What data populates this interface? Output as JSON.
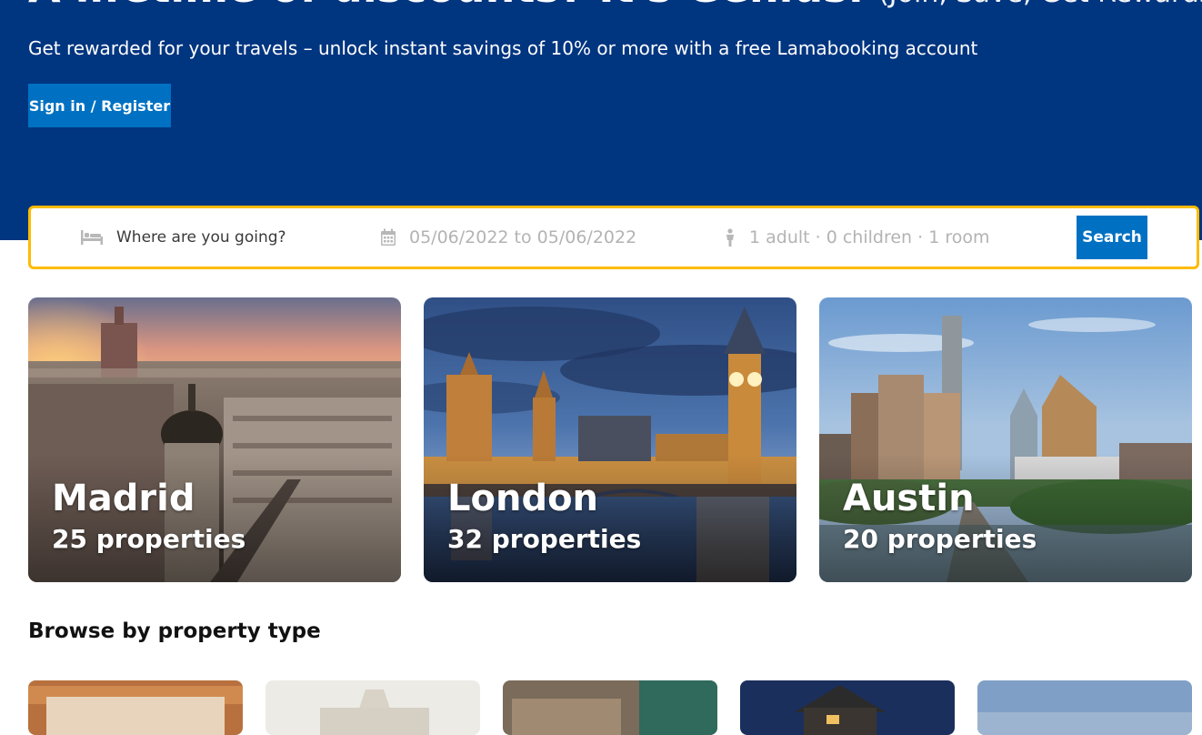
{
  "header": {
    "title": "A lifetime of discounts? It's Genius.",
    "title_suffix": "(Join, Save, Get Rewards)",
    "description": "Get rewarded for your travels – unlock instant savings of 10% or more with a free Lamabooking account",
    "signin_label": "Sign in / Register",
    "background_color": "#003580"
  },
  "search": {
    "destination_placeholder": "Where are you going?",
    "dates": "05/06/2022 to 05/06/2022",
    "guests": "1 adult · 0 children · 1 room",
    "button_label": "Search",
    "border_color": "#febb02",
    "button_color": "#0071c2",
    "icons": [
      "bed-icon",
      "calendar-icon",
      "person-icon"
    ]
  },
  "featured": [
    {
      "city": "Madrid",
      "properties": "25 properties"
    },
    {
      "city": "London",
      "properties": "32 properties"
    },
    {
      "city": "Austin",
      "properties": "20 properties"
    }
  ],
  "property_types": {
    "title": "Browse by property type"
  }
}
